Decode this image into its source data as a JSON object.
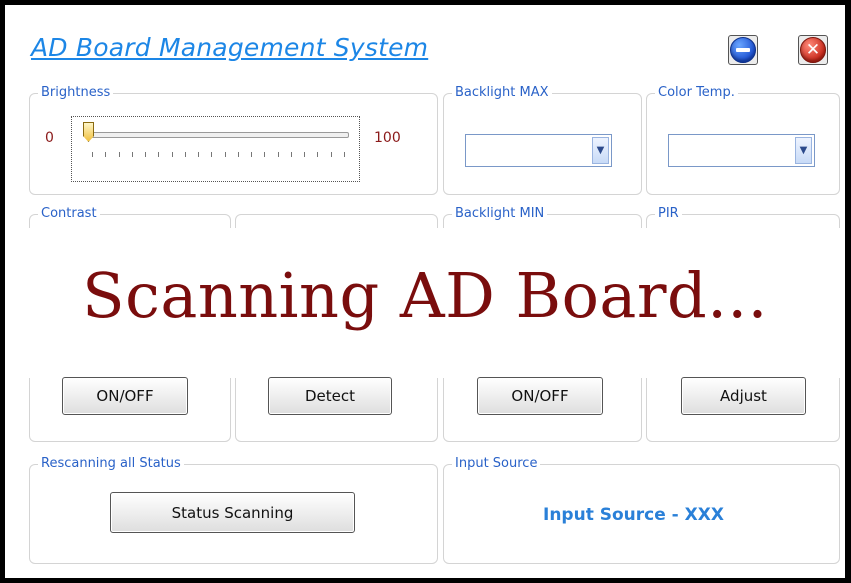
{
  "app": {
    "title": "AD Board Management System"
  },
  "window_buttons": {
    "minimize_icon": "minimize-icon",
    "close_icon": "close-icon",
    "close_glyph": "✕"
  },
  "groups": {
    "brightness": "Brightness",
    "backlight_max": "Backlight MAX",
    "color_temp": "Color Temp.",
    "contrast": "Contrast",
    "backlight_min": "Backlight MIN",
    "pir": "PIR",
    "rescanning": "Rescanning all Status",
    "input_source": "Input Source"
  },
  "brightness": {
    "min_label": "0",
    "max_label": "100",
    "value": 0,
    "tick_count": 20
  },
  "combos": {
    "backlight_max_value": "",
    "color_temp_value": ""
  },
  "overlay": {
    "message": "Scanning AD Board..."
  },
  "buttons": {
    "contrast_onoff": "ON/OFF",
    "detect": "Detect",
    "backlight_onoff": "ON/OFF",
    "adjust": "Adjust",
    "status_scanning": "Status Scanning"
  },
  "input_source": {
    "value": "Input Source - XXX"
  },
  "colors": {
    "title": "#1c86e6",
    "group_label": "#2a62c8",
    "overlay_text": "#7a0d0d",
    "input_source": "#2a80d8"
  }
}
